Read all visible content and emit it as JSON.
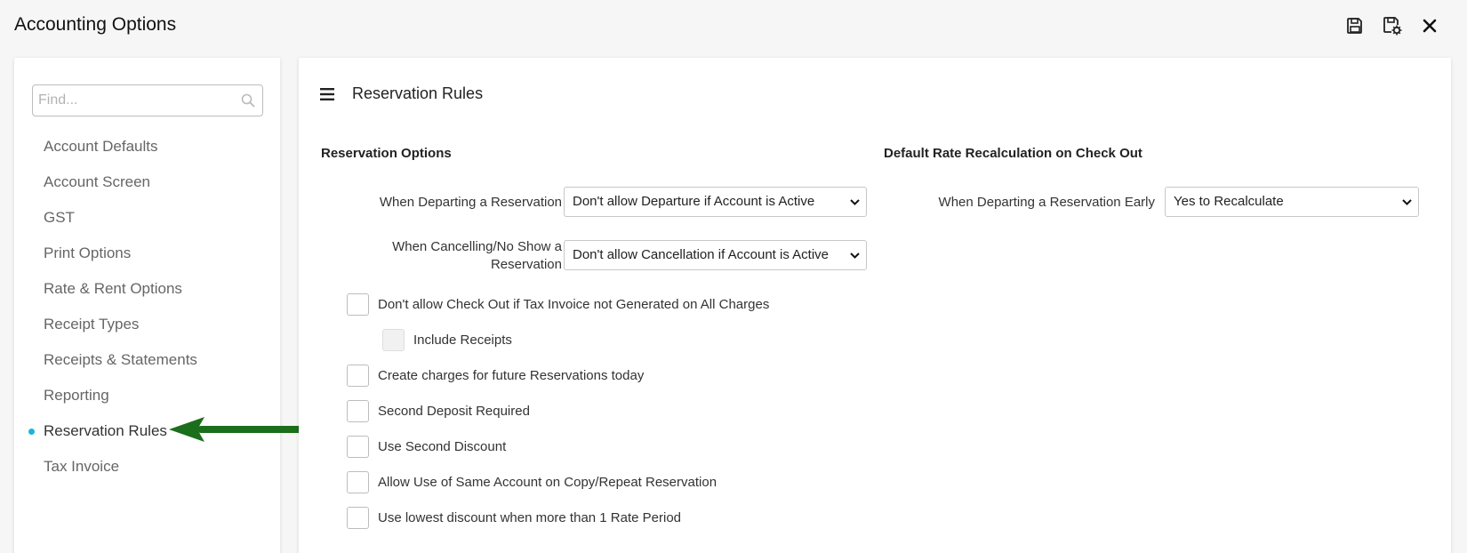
{
  "window": {
    "title": "Accounting Options"
  },
  "toolbar": {
    "save_icon": "save-icon",
    "save_settings_icon": "save-settings-icon",
    "close_icon": "close-icon"
  },
  "sidebar": {
    "search_placeholder": "Find...",
    "items": [
      {
        "label": "Account Defaults",
        "active": false
      },
      {
        "label": "Account Screen",
        "active": false
      },
      {
        "label": "GST",
        "active": false
      },
      {
        "label": "Print Options",
        "active": false
      },
      {
        "label": "Rate & Rent Options",
        "active": false
      },
      {
        "label": "Receipt Types",
        "active": false
      },
      {
        "label": "Receipts & Statements",
        "active": false
      },
      {
        "label": "Reporting",
        "active": false
      },
      {
        "label": "Reservation Rules",
        "active": true
      },
      {
        "label": "Tax Invoice",
        "active": false
      }
    ]
  },
  "main": {
    "title": "Reservation Rules",
    "reservation_options": {
      "heading": "Reservation Options",
      "departing_label": "When Departing a Reservation",
      "departing_value": "Don't allow Departure if Account is Active",
      "cancelling_label_1": "When Cancelling/No Show a",
      "cancelling_label_2": "Reservation",
      "cancelling_value": "Don't allow Cancellation if Account is Active"
    },
    "default_rate": {
      "heading": "Default Rate Recalculation on Check Out",
      "early_label": "When Departing a Reservation Early",
      "early_value": "Yes to Recalculate"
    },
    "checkboxes": [
      {
        "label": "Don't allow Check Out if Tax Invoice not Generated on All Charges",
        "checked": false
      },
      {
        "label": "Include Receipts",
        "checked": false,
        "disabled": true
      },
      {
        "label": "Create charges for future Reservations today",
        "checked": false
      },
      {
        "label": "Second Deposit Required",
        "checked": false
      },
      {
        "label": "Use Second Discount",
        "checked": false
      },
      {
        "label": "Allow Use of Same Account on Copy/Repeat Reservation",
        "checked": false
      },
      {
        "label": "Use lowest discount when more than 1 Rate Period",
        "checked": false
      }
    ]
  },
  "colors": {
    "accent": "#19b6d8",
    "arrow": "#1b6e1b"
  }
}
